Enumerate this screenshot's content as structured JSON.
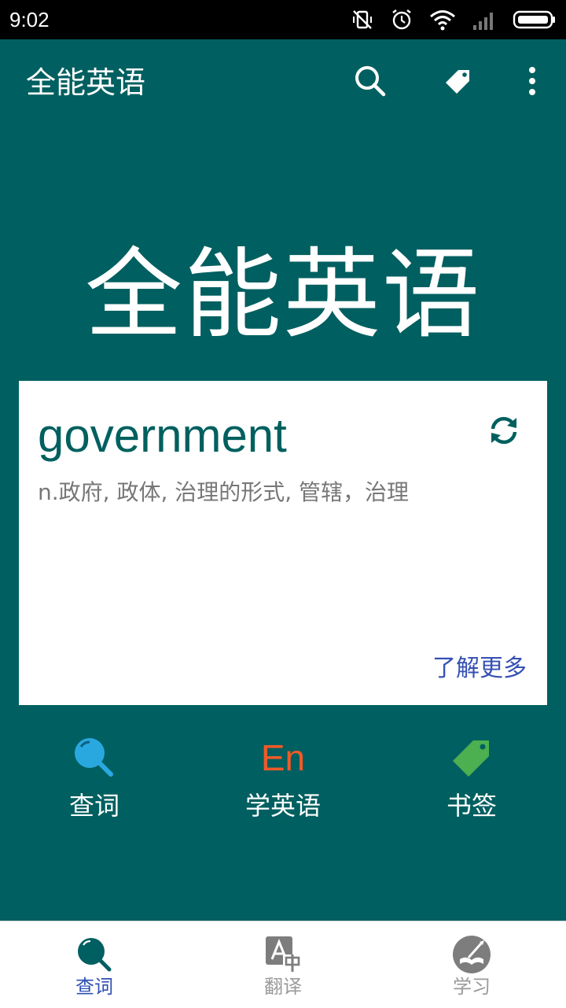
{
  "status_bar": {
    "time": "9:02"
  },
  "app_bar": {
    "title": "全能英语",
    "actions": [
      "search-icon",
      "tag-icon",
      "more-vert-icon"
    ]
  },
  "hero": {
    "title": "全能英语"
  },
  "word_card": {
    "word": "government",
    "definition": "n.政府, 政体, 治理的形式, 管辖，治理",
    "learn_more": "了解更多"
  },
  "shortcuts": [
    {
      "label": "查词",
      "icon": "magnifier-icon"
    },
    {
      "label": "学英语",
      "icon": "en-icon",
      "glyph": "En"
    },
    {
      "label": "书签",
      "icon": "bookmark-tag-icon"
    }
  ],
  "bottom_nav": [
    {
      "label": "查词",
      "icon": "search-nav-icon",
      "active": true
    },
    {
      "label": "翻译",
      "icon": "translate-icon",
      "active": false
    },
    {
      "label": "学习",
      "icon": "study-icon",
      "active": false
    }
  ],
  "colors": {
    "primary": "#005f60",
    "accent_blue": "#2e4fb0",
    "en_orange": "#f05a28",
    "magnifier_blue": "#29a8e0",
    "tag_green": "#4caf50"
  }
}
